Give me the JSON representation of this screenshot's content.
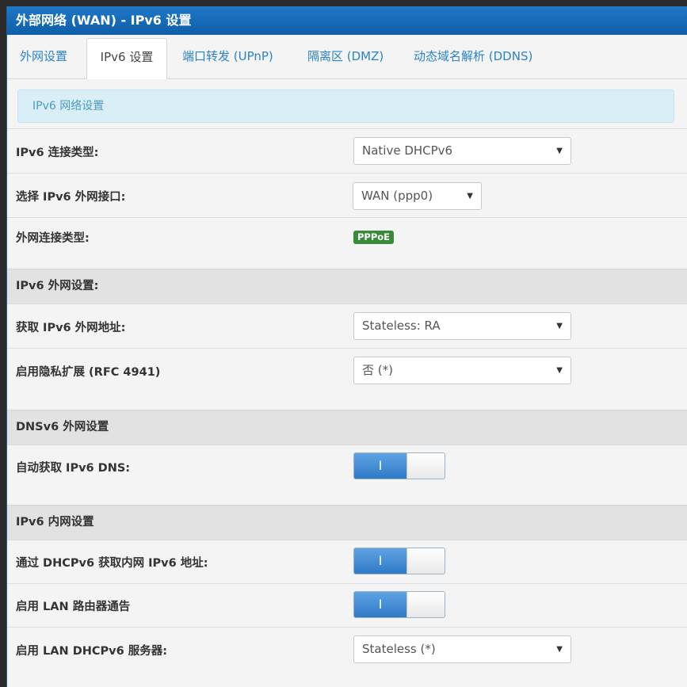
{
  "header": {
    "title": "外部网络 (WAN) - IPv6 设置"
  },
  "tabs": [
    {
      "label": "外网设置"
    },
    {
      "label": "IPv6 设置"
    },
    {
      "label": "端口转发 (UPnP)"
    },
    {
      "label": "隔离区 (DMZ)"
    },
    {
      "label": "动态域名解析 (DDNS)"
    }
  ],
  "info": {
    "text": "IPv6 网络设置"
  },
  "fields": {
    "conn_type": {
      "label": "IPv6 连接类型:",
      "value": "Native DHCPv6"
    },
    "wan_if": {
      "label": "选择 IPv6 外网接口:",
      "value": "WAN (ppp0)"
    },
    "wan_conn": {
      "label": "外网连接类型:",
      "badge": "PPPoE"
    },
    "get_addr": {
      "label": "获取 IPv6 外网地址:",
      "value": "Stateless: RA"
    },
    "privacy": {
      "label": "启用隐私扩展 (RFC 4941)",
      "value": "否 (*)"
    },
    "auto_dns": {
      "label": "自动获取 IPv6 DNS:",
      "toggle": "I"
    },
    "dhcpv6_lan": {
      "label": "通过 DHCPv6 获取内网 IPv6 地址:",
      "toggle": "I"
    },
    "lan_ra": {
      "label": "启用 LAN 路由器通告",
      "toggle": "I"
    },
    "lan_dhcpv6": {
      "label": "启用 LAN DHCPv6 服务器:",
      "value": "Stateless (*)"
    }
  },
  "sections": {
    "wan": "IPv6 外网设置:",
    "dns": "DNSv6 外网设置",
    "lan": "IPv6 内网设置"
  },
  "icons": {
    "dropdown": "caret-down-icon"
  },
  "colors": {
    "accent": "#1f78c6",
    "badge": "#3a8a3a",
    "toggle_on": "#2f79c6"
  }
}
